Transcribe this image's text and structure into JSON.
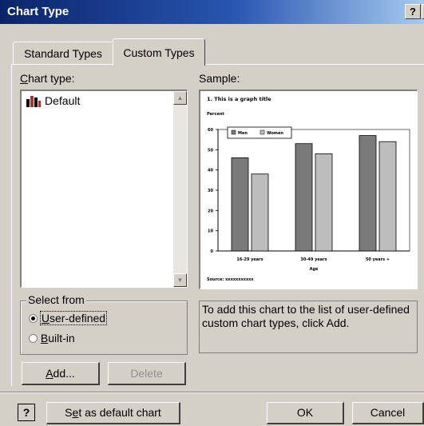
{
  "window": {
    "title": "Chart Type",
    "help_button": "?"
  },
  "tabs": [
    {
      "label": "Standard Types"
    },
    {
      "label": "Custom Types"
    }
  ],
  "chart_type": {
    "label_prefix": "C",
    "label_rest": "hart type:",
    "items": [
      {
        "label": "Default",
        "icon": "bar-chart-icon"
      }
    ]
  },
  "sample_label": "Sample:",
  "select_from": {
    "legend": "Select from",
    "options": [
      {
        "mnemonic": "U",
        "rest": "ser-defined",
        "selected": true
      },
      {
        "mnemonic": "B",
        "rest": "uilt-in",
        "selected": false
      }
    ]
  },
  "buttons": {
    "add_mnemonic": "A",
    "add_rest": "dd...",
    "delete": "Delete",
    "default_pre": "S",
    "default_mnemonic": "e",
    "default_rest": "t as default chart",
    "ok": "OK",
    "cancel": "Cancel"
  },
  "description": "To add this chart to the list of user-defined custom chart types, click Add.",
  "colors": {
    "men": "#7a7a7a",
    "women": "#bdbdbd"
  },
  "chart_data": {
    "type": "bar",
    "title": "1. This is a graph title",
    "ylabel": "Percent",
    "xlabel": "Age",
    "source": "Source: xxxxxxxxxxx",
    "categories": [
      "16-29 years",
      "30-49 years",
      "50 years +"
    ],
    "series": [
      {
        "name": "Men",
        "values": [
          46,
          53,
          57
        ]
      },
      {
        "name": "Women",
        "values": [
          38,
          48,
          54
        ]
      }
    ],
    "yticks": [
      0,
      10,
      20,
      30,
      40,
      50,
      60
    ],
    "ylim": [
      0,
      60
    ],
    "grid": false,
    "legend": "top-left"
  }
}
